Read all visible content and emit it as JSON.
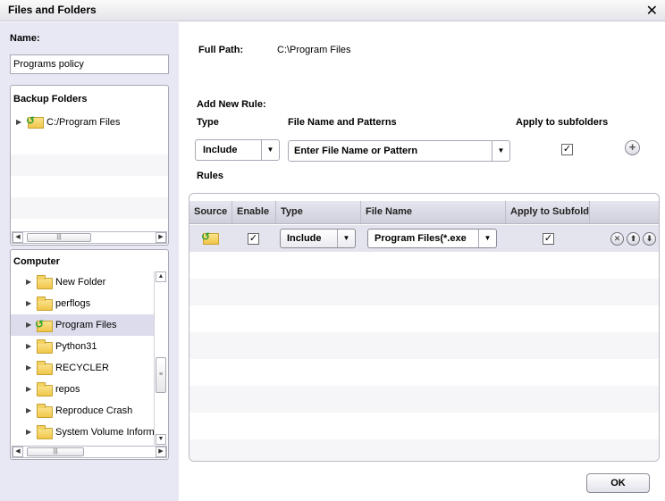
{
  "window": {
    "title": "Files and Folders",
    "close_icon": "close-icon"
  },
  "left": {
    "name_label": "Name:",
    "name_value": "Programs policy",
    "backup": {
      "heading": "Backup Folders",
      "items": [
        {
          "label": "C:/Program Files",
          "icon": "restore-folder-icon"
        }
      ]
    },
    "computer": {
      "heading": "Computer",
      "items": [
        {
          "label": "New Folder",
          "icon": "folder-icon"
        },
        {
          "label": "perflogs",
          "icon": "folder-icon"
        },
        {
          "label": "Program Files",
          "icon": "restore-folder-icon",
          "selected": true
        },
        {
          "label": "Python31",
          "icon": "folder-icon"
        },
        {
          "label": "RECYCLER",
          "icon": "folder-icon"
        },
        {
          "label": "repos",
          "icon": "folder-icon"
        },
        {
          "label": "Reproduce Crash",
          "icon": "folder-icon"
        },
        {
          "label": "System Volume Information",
          "icon": "folder-icon"
        }
      ]
    }
  },
  "main": {
    "full_path_label": "Full Path:",
    "full_path_value": "C:\\Program Files",
    "add_rule": {
      "heading": "Add New Rule:",
      "type_label": "Type",
      "type_value": "Include",
      "pattern_label": "File Name and Patterns",
      "pattern_placeholder": "Enter File Name or Pattern",
      "subfolders_label": "Apply to subfolders",
      "subfolders_checked": "✓",
      "add_icon": "plus-icon"
    },
    "rules": {
      "heading": "Rules",
      "columns": [
        "Source",
        "Enable",
        "Type",
        "File Name",
        "Apply to Subfolders"
      ],
      "rows": [
        {
          "enable": "✓",
          "type": "Include",
          "file_name": "Program Files(*.exe",
          "apply": "✓"
        }
      ]
    },
    "ok_label": "OK"
  }
}
